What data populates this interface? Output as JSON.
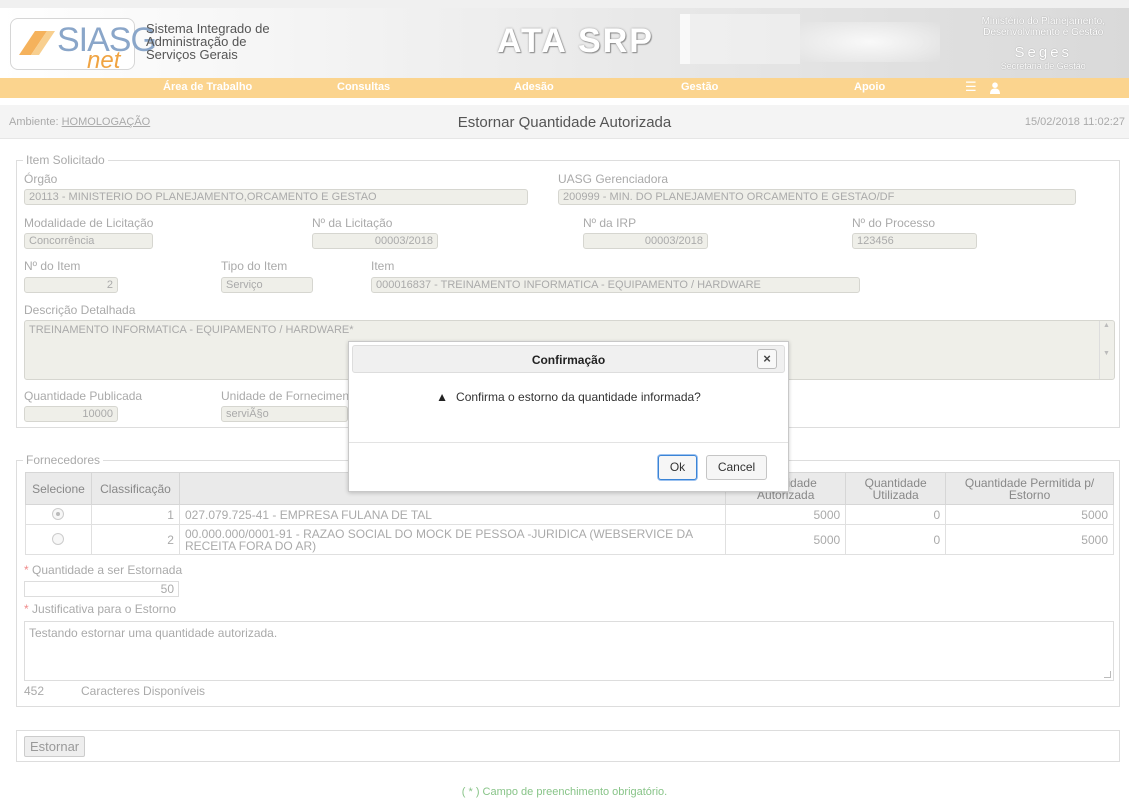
{
  "header": {
    "logo_main": "SIASG",
    "logo_sub": "net",
    "system_name": [
      "Sistema Integrado de",
      "Administração de",
      "Serviços Gerais"
    ],
    "app_title": "ATA SRP",
    "ministry": [
      "Ministério do Planejamento,",
      "Desenvolvimento e Gestão"
    ],
    "seges": "Seges",
    "seges_sub": "Secretaria de Gestão"
  },
  "nav": {
    "items": [
      "Área de Trabalho",
      "Consultas",
      "Adesão",
      "Gestão",
      "Apoio"
    ],
    "menu_icon": "hamburger-menu-icon",
    "user_icon": "user-icon"
  },
  "ambient": {
    "label": "Ambiente: ",
    "value": "HOMOLOGAÇÃO",
    "page_title": "Estornar Quantidade Autorizada",
    "datetime": "15/02/2018 11:02:27"
  },
  "item": {
    "legend": "Item Solicitado",
    "orgao_label": "Órgão",
    "orgao_value": "20113 - MINISTERIO DO PLANEJAMENTO,ORCAMENTO E GESTAO",
    "uasg_label": "UASG Gerenciadora",
    "uasg_value": "200999 - MIN. DO PLANEJAMENTO ORCAMENTO E GESTAO/DF",
    "modalidade_label": "Modalidade de Licitação",
    "modalidade_value": "Concorrência",
    "licitacao_label": "Nº da Licitação",
    "licitacao_value": "00003/2018",
    "irp_label": "Nº da IRP",
    "irp_value": "00003/2018",
    "processo_label": "Nº do Processo",
    "processo_value": "123456",
    "num_item_label": "Nº do Item",
    "num_item_value": "2",
    "tipo_label": "Tipo do Item",
    "tipo_value": "Serviço",
    "item_label": "Item",
    "item_value": "000016837 - TREINAMENTO INFORMATICA - EQUIPAMENTO / HARDWARE",
    "descricao_label": "Descrição Detalhada",
    "descricao_value": "TREINAMENTO INFORMATICA - EQUIPAMENTO / HARDWARE*",
    "qtd_pub_label": "Quantidade Publicada",
    "qtd_pub_value": "10000",
    "unidade_label": "Unidade de Fornecimento",
    "unidade_value": "serviÃ§o"
  },
  "fornecedores": {
    "legend": "Fornecedores",
    "columns": [
      "Selecione",
      "Classificação",
      "",
      "Quantidade Autorizada",
      "Quantidade Utilizada",
      "Quantidade Permitida p/ Estorno"
    ],
    "rows": [
      {
        "selected": true,
        "classificacao": "1",
        "fornecedor": "027.079.725-41 - EMPRESA FULANA DE TAL",
        "autorizada": "5000",
        "utilizada": "0",
        "permitida": "5000"
      },
      {
        "selected": false,
        "classificacao": "2",
        "fornecedor": "00.000.000/0001-91 - RAZAO SOCIAL DO MOCK DE PESSOA -JURIDICA (WEBSERVICE DA RECEITA FORA DO AR)",
        "autorizada": "5000",
        "utilizada": "0",
        "permitida": "5000"
      }
    ],
    "qtd_estornar_label": "Quantidade a ser Estornada",
    "qtd_estornar_value": "50",
    "justificativa_label": "Justificativa para o Estorno",
    "justificativa_value": "Testando estornar uma quantidade autorizada.",
    "chars_count": "452",
    "chars_label": "Caracteres Disponíveis"
  },
  "actions": {
    "estornar": "Estornar",
    "footer_note": "( * ) Campo de preenchimento obrigatório."
  },
  "dialog": {
    "title": "Confirmação",
    "close": "×",
    "message": "Confirma o estorno da quantidade informada?",
    "ok": "Ok",
    "cancel": "Cancel"
  },
  "colors": {
    "nav_bg": "#fbd48e",
    "required": "#f08a8a",
    "footer_note": "#88c488",
    "ok_focus": "#3b84d6"
  }
}
